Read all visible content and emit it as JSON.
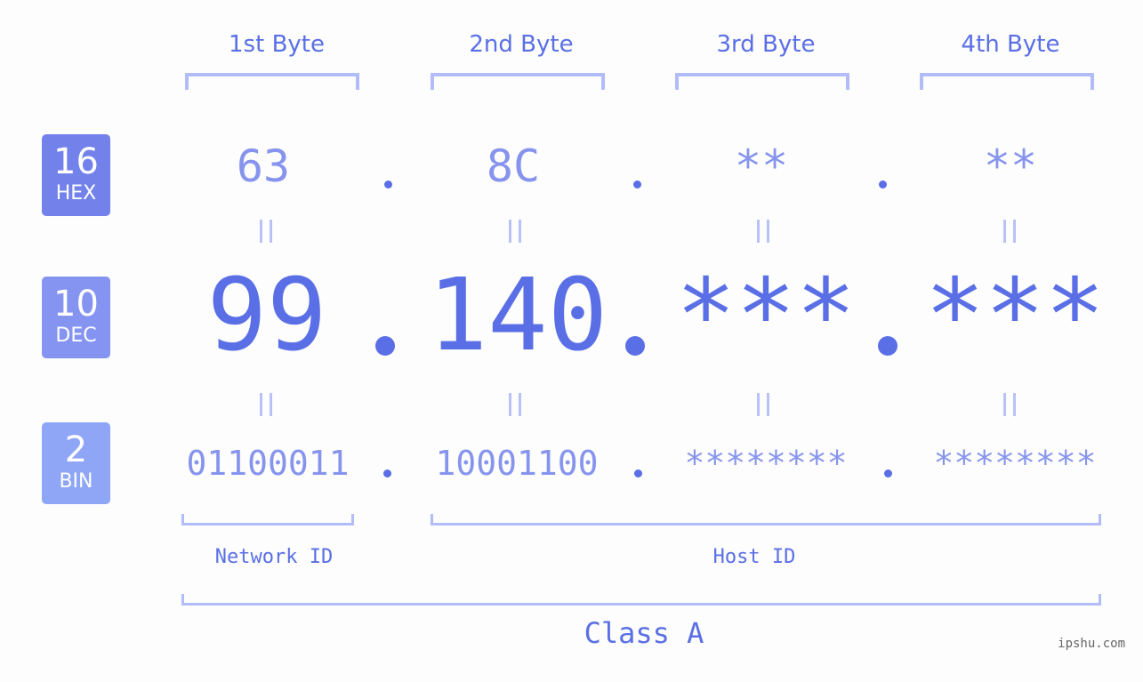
{
  "badges": [
    {
      "num": "16",
      "label": "HEX",
      "color": "#7382ea"
    },
    {
      "num": "10",
      "label": "DEC",
      "color": "#8594f0"
    },
    {
      "num": "2",
      "label": "BIN",
      "color": "#8fa6f7"
    }
  ],
  "byte_headers": [
    "1st Byte",
    "2nd Byte",
    "3rd Byte",
    "4th Byte"
  ],
  "hex": [
    "63",
    "8C",
    "**",
    "**"
  ],
  "dec": [
    "99",
    "140",
    "***",
    "***"
  ],
  "bin": [
    "01100011",
    "10001100",
    "********",
    "********"
  ],
  "equals_glyph": "=",
  "network_label": "Network ID",
  "host_label": "Host ID",
  "class_label": "Class A",
  "watermark": "ipshu.com",
  "colors": {
    "primary": "#5a6fe6",
    "secondary": "#8794ee",
    "bracket": "#b2bcf8"
  }
}
